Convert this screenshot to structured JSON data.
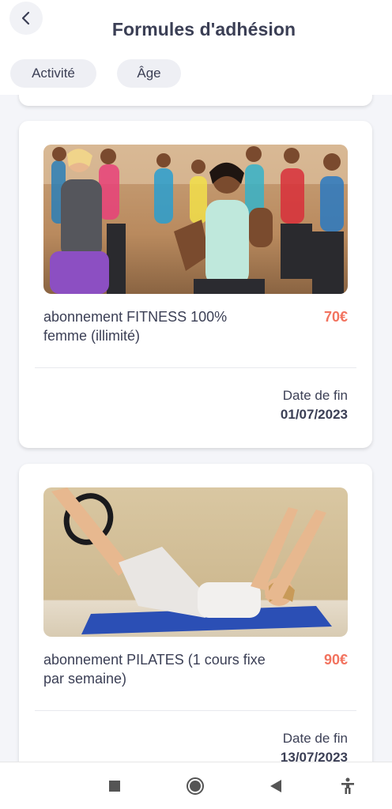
{
  "header": {
    "title": "Formules d'adhésion",
    "back_icon": "chevron-left-icon"
  },
  "filters": [
    {
      "label": "Activité"
    },
    {
      "label": "Âge"
    }
  ],
  "cards": [
    {
      "name": "abonnement FITNESS 100% femme (illimité)",
      "price": "70€",
      "end_label": "Date de fin",
      "end_date": "01/07/2023"
    },
    {
      "name": "abonnement PILATES (1 cours fixe par semaine)",
      "price": "90€",
      "end_label": "Date de fin",
      "end_date": "13/07/2023"
    }
  ],
  "navbar": {
    "icons": [
      "recents-square-icon",
      "home-circle-icon",
      "back-triangle-icon",
      "accessibility-icon"
    ]
  },
  "colors": {
    "price": "#f2735f",
    "text": "#3b3f55",
    "chip": "#eeeff4",
    "background": "#f4f5f9"
  }
}
